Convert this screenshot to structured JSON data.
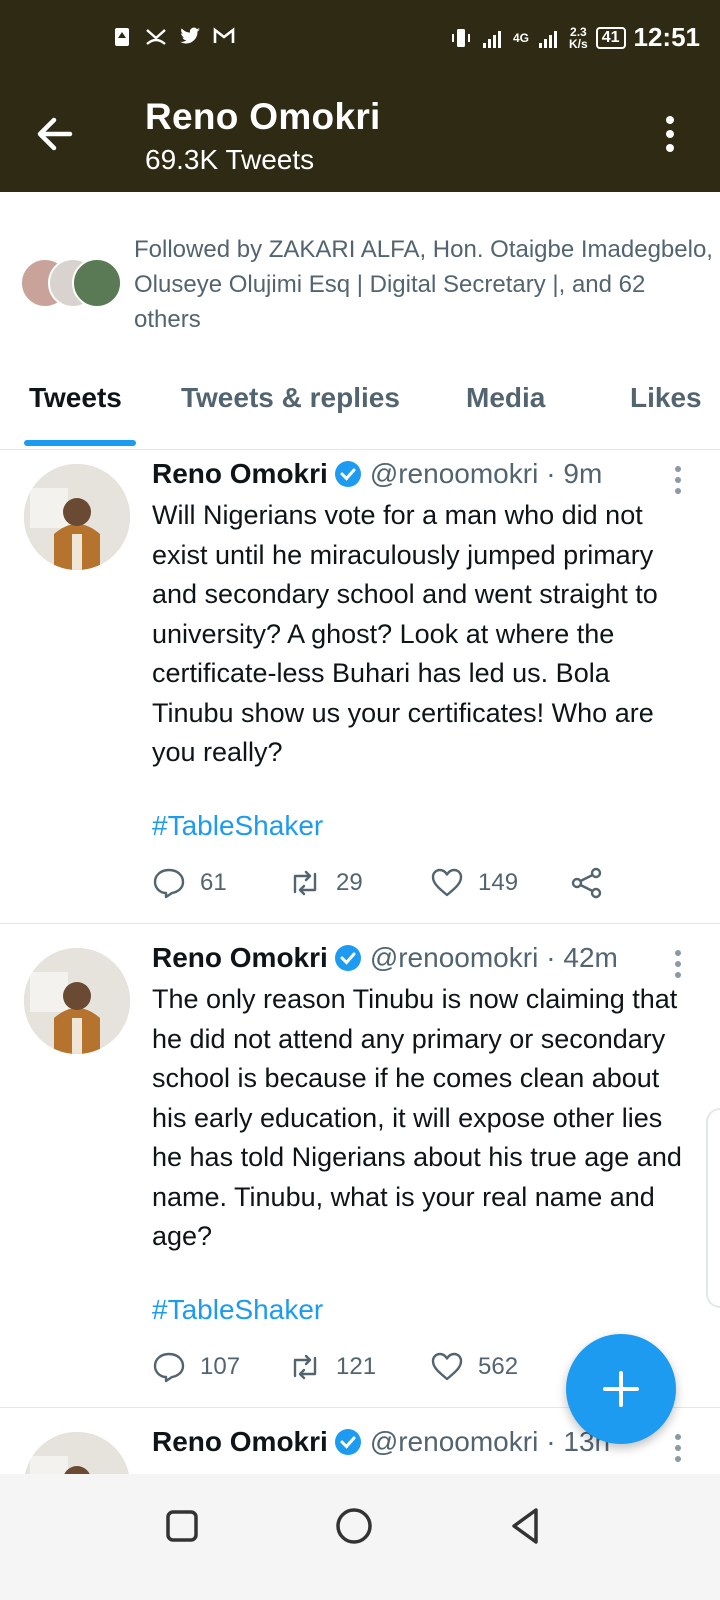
{
  "status_bar": {
    "time": "12:51",
    "network_type": "4G",
    "speed_value": "2.3",
    "speed_unit": "K/s",
    "battery": "41",
    "left_icons": [
      "notification-icon",
      "missed-call-icon",
      "twitter-icon",
      "gmail-icon"
    ],
    "right_icons": [
      "vibrate-icon",
      "signal-icon",
      "signal-icon-2",
      "battery-icon"
    ]
  },
  "header": {
    "title": "Reno Omokri",
    "subtitle": "69.3K Tweets"
  },
  "followers": {
    "text": "Followed by ZAKARI ALFA, Hon. Otaigbe Imadegbelo, Oluseye Olujimi Esq | Digital Secretary |, and 62 others"
  },
  "tabs": [
    {
      "label": "Tweets",
      "active": true
    },
    {
      "label": "Tweets & replies",
      "active": false
    },
    {
      "label": "Media",
      "active": false
    },
    {
      "label": "Likes",
      "active": false
    }
  ],
  "tweets": [
    {
      "name": "Reno Omokri",
      "handle": "@renoomokri",
      "time": "· 9m",
      "text": "Will Nigerians vote for a man who did not exist until he miraculously jumped primary and secondary school and went straight to university? A ghost? Look at where the certificate-less Buhari has led us. Bola Tinubu show us your certificates! Who are you really?",
      "hashtag": "#TableShaker",
      "replies": "61",
      "retweets": "29",
      "likes": "149"
    },
    {
      "name": "Reno Omokri",
      "handle": "@renoomokri",
      "time": "· 42m",
      "text": "The only reason Tinubu is now claiming that he did not attend any primary or secondary school is because if he comes clean about his early education, it will expose other lies he has told Nigerians about his true age and name. Tinubu, what is your real name and age?",
      "hashtag": "#TableShaker",
      "replies": "107",
      "retweets": "121",
      "likes": "562"
    },
    {
      "name": "Reno Omokri",
      "handle": "@renoomokri",
      "time": "· 13h"
    }
  ],
  "colors": {
    "header_bg": "#2e2a14",
    "accent": "#1d9bf0",
    "muted_text": "#536471"
  }
}
